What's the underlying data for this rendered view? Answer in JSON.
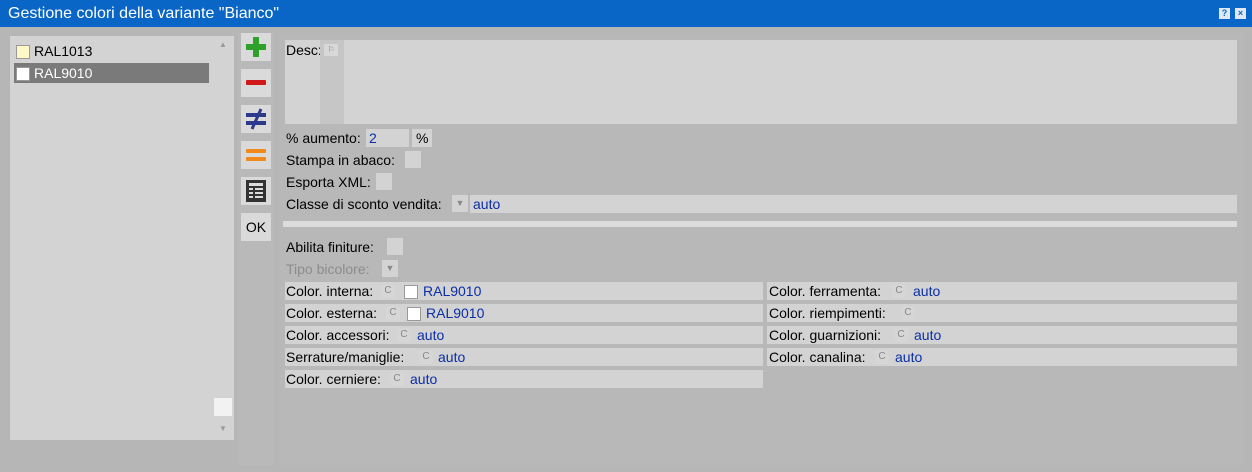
{
  "window": {
    "title": "Gestione colori della variante \"Bianco\"",
    "help_glyph": "?",
    "close_glyph": "×"
  },
  "list": {
    "items": [
      {
        "label": "RAL1013",
        "swatch": "#fdf8c6",
        "selected": false
      },
      {
        "label": "RAL9010",
        "swatch": "#ffffff",
        "selected": true
      }
    ]
  },
  "toolbar": {
    "ok_label": "OK"
  },
  "form": {
    "desc_label": "Desc:",
    "aumento_label": "% aumento:",
    "aumento_value": "2",
    "aumento_unit": "%",
    "stampa_label": "Stampa in abaco:",
    "esporta_label": "Esporta XML:",
    "classe_label": "Classe di sconto vendita:",
    "classe_value": "auto",
    "abilita_label": "Abilita finiture:",
    "tipo_label": "Tipo bicolore:",
    "left_rows": [
      {
        "label": "Color. interna:",
        "value": "RAL9010"
      },
      {
        "label": "Color. esterna:",
        "value": "RAL9010"
      },
      {
        "label": "Color. accessori:",
        "value": "auto"
      },
      {
        "label": "Serrature/maniglie:",
        "value": "auto"
      },
      {
        "label": "Color. cerniere:",
        "value": "auto"
      }
    ],
    "right_rows": [
      {
        "label": "Color. ferramenta:",
        "value": "auto"
      },
      {
        "label": "Color. riempimenti:",
        "value": ""
      },
      {
        "label": "Color. guarnizioni:",
        "value": "auto"
      },
      {
        "label": "Color. canalina:",
        "value": "auto"
      }
    ],
    "c_glyph": "C"
  }
}
